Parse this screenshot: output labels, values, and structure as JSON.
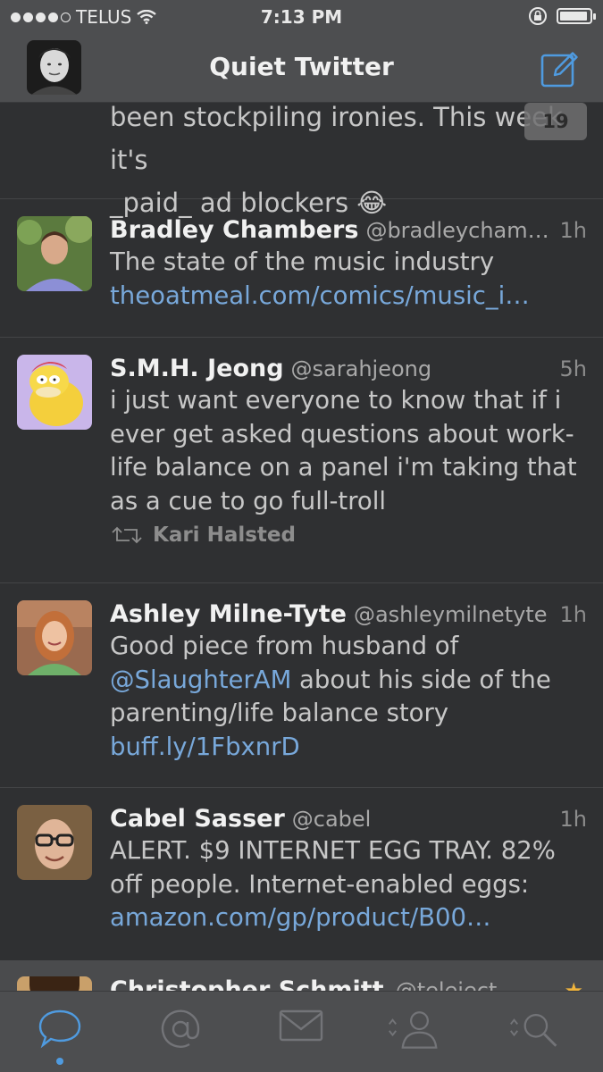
{
  "status_bar": {
    "carrier": "TELUS",
    "time": "7:13 PM",
    "signal_bars": 4,
    "battery_level": 0.95
  },
  "nav": {
    "title": "Quiet Twitter"
  },
  "unread_count": "19",
  "partial_tweet": {
    "text_line1": "been stockpiling ironies. This week it's",
    "text_line2": "_paid_ ad blockers 😂"
  },
  "tweets": [
    {
      "name": "Bradley Chambers",
      "handle": "@bradleycham…",
      "age": "1h",
      "text": "The state of the music industry",
      "link": "theoatmeal.com/comics/music_i…"
    },
    {
      "name": "S.M.H. Jeong",
      "handle": "@sarahjeong",
      "age": "5h",
      "text": "i just want everyone to know that if i ever get asked questions about work-life balance on a panel i'm taking that as a cue to go full-troll",
      "retweeted_by": "Kari Halsted"
    },
    {
      "name": "Ashley Milne-Tyte",
      "handle": "@ashleymilnetyte",
      "age": "1h",
      "text_before": "Good piece from husband of ",
      "mention": "@SlaughterAM",
      "text_after": " about his side of the parenting/life balance story ",
      "link": "buff.ly/1FbxnrD"
    },
    {
      "name": "Cabel Sasser",
      "handle": "@cabel",
      "age": "1h",
      "text": "ALERT. $9 INTERNET EGG TRAY. 82% off people. Internet-enabled eggs:",
      "link": "amazon.com/gp/product/B00…"
    },
    {
      "name": "Christopher Schmitt",
      "handle": "@teleject"
    }
  ],
  "tabs": [
    {
      "icon": "speech-bubble-icon",
      "selected": true
    },
    {
      "icon": "at-sign-icon",
      "selected": false
    },
    {
      "icon": "envelope-icon",
      "selected": false
    },
    {
      "icon": "person-icon",
      "selected": false
    },
    {
      "icon": "search-icon",
      "selected": false
    }
  ],
  "colors": {
    "background": "#2f3032",
    "bars": "#4d4e50",
    "link": "#78a8da",
    "accent": "#4f9be0"
  }
}
